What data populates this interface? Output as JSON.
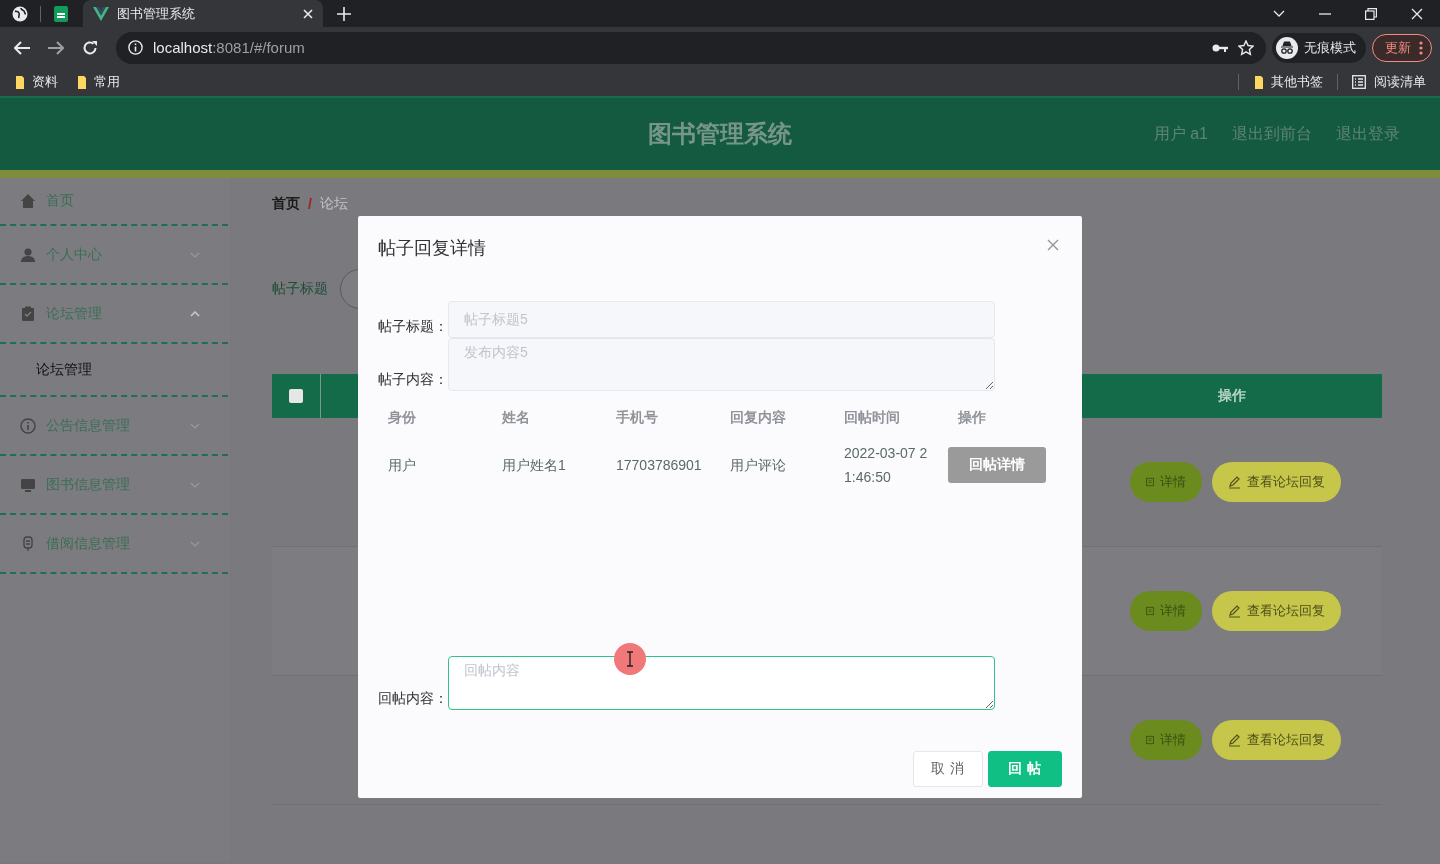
{
  "browser": {
    "tabs": [
      {
        "title": "图书管理系统",
        "selected": true
      }
    ],
    "address": "**localhost**:8081/#/forum",
    "profile_label": "无痕模式",
    "update_label": "更新",
    "bookmarks": [
      "资料",
      "常用"
    ],
    "other_bookmarks": "其他书签",
    "reading_list": "阅读清单"
  },
  "header": {
    "title": "图书管理系统",
    "links": [
      "用户 a1",
      "退出到前台",
      "退出登录"
    ]
  },
  "sidebar": {
    "items": [
      {
        "label": "首页",
        "kind": "link"
      },
      {
        "label": "个人中心",
        "kind": "submenu",
        "expanded": false
      },
      {
        "label": "论坛管理",
        "kind": "submenu",
        "expanded": true,
        "children": [
          {
            "label": "论坛管理"
          }
        ]
      },
      {
        "label": "公告信息管理",
        "kind": "submenu",
        "expanded": false
      },
      {
        "label": "图书信息管理",
        "kind": "submenu",
        "expanded": false
      },
      {
        "label": "借阅信息管理",
        "kind": "submenu",
        "expanded": false
      }
    ]
  },
  "breadcrumb": {
    "items": [
      "首页",
      "论坛"
    ],
    "separator": "/"
  },
  "search": {
    "label": "帖子标题"
  },
  "table": {
    "select_all": {
      "checked": false
    },
    "columns": [
      "操作"
    ],
    "rows": [
      {
        "actions": [
          "详情",
          "查看论坛回复"
        ]
      },
      {
        "actions": [
          "详情",
          "查看论坛回复"
        ]
      },
      {
        "actions": [
          "详情",
          "查看论坛回复"
        ]
      }
    ]
  },
  "dialog": {
    "title": "帖子回复详情",
    "fields": [
      {
        "label": "帖子标题：",
        "value": "帖子标题5",
        "kind": "input",
        "disabled": true
      },
      {
        "label": "帖子内容：",
        "value": "发布内容5",
        "kind": "textarea",
        "disabled": true
      }
    ],
    "table": {
      "columns": [
        "身份",
        "姓名",
        "手机号",
        "回复内容",
        "回帖时间",
        "操作"
      ],
      "rows": [
        {
          "cells": [
            "用户",
            "用户姓名1",
            "17703786901",
            "用户评论",
            "2022-03-07 21:46:50"
          ],
          "action": "回帖详情"
        }
      ]
    },
    "reply": {
      "label": "回帖内容：",
      "placeholder": "回帖内容"
    },
    "buttons": [
      {
        "label": "取 消",
        "kind": "default"
      },
      {
        "label": "回 帖",
        "kind": "primary"
      }
    ]
  }
}
